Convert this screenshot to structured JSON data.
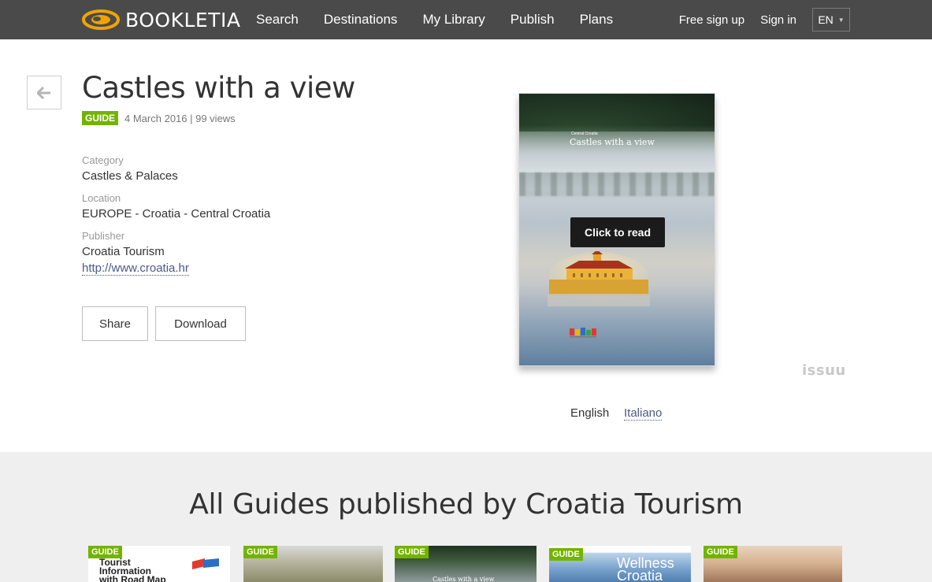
{
  "header": {
    "brand": "BOOKLETIA",
    "nav": [
      "Search",
      "Destinations",
      "My Library",
      "Publish",
      "Plans"
    ],
    "signup": "Free sign up",
    "signin": "Sign in",
    "language": "EN"
  },
  "publication": {
    "title": "Castles with a view",
    "badge": "GUIDE",
    "meta": "4 March 2016 | 99 views",
    "category_label": "Category",
    "category": "Castles & Palaces",
    "location_label": "Location",
    "location": "EUROPE - Croatia - Central Croatia",
    "publisher_label": "Publisher",
    "publisher": "Croatia Tourism",
    "publisher_url": "http://www.croatia.hr",
    "share_label": "Share",
    "download_label": "Download"
  },
  "cover": {
    "subtitle": "Central Croatia",
    "title": "Castles with a view",
    "read_label": "Click to read",
    "viewer_brand": "issuu"
  },
  "languages": {
    "current": "English",
    "other": "Italiano"
  },
  "related": {
    "title": "All Guides published by Croatia Tourism",
    "cards": [
      {
        "badge": "GUIDE",
        "text": "Tourist Information with Road Map"
      },
      {
        "badge": "GUIDE",
        "text": ""
      },
      {
        "badge": "GUIDE",
        "text": "Castles with a view"
      },
      {
        "badge": "GUIDE",
        "text": "Wellness Croatia"
      },
      {
        "badge": "GUIDE",
        "text": ""
      }
    ]
  },
  "colors": {
    "topbar": "#4a4a4a",
    "badge": "#73b300",
    "link": "#4b5a86",
    "section_bg": "#efefef"
  }
}
